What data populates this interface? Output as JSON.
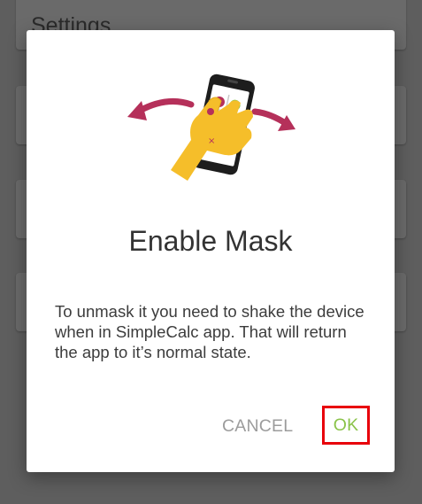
{
  "background": {
    "title": "Settings"
  },
  "dialog": {
    "title": "Enable Mask",
    "message": "To unmask it you need to shake the device when in SimpleCalc app. That will return the app to it’s normal state.",
    "illustration_icon": "shake-phone-icon",
    "cancel_label": "CANCEL",
    "ok_label": "OK"
  },
  "colors": {
    "ok_text": "#8bc34a",
    "highlight_border": "#e8000b",
    "arrow": "#b5305a",
    "hand": "#f5be2a"
  }
}
